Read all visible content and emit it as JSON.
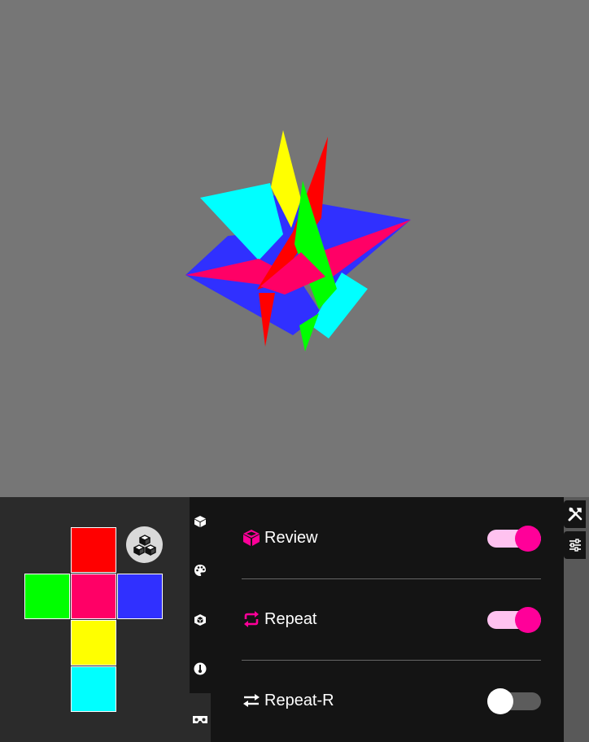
{
  "scene": {
    "background": "#767676",
    "shapes": [
      {
        "color": "#3030ff",
        "desc": "blue triangle right"
      },
      {
        "color": "#3030ff",
        "desc": "blue quad left"
      },
      {
        "color": "#00ffff",
        "desc": "cyan top-left"
      },
      {
        "color": "#00ffff",
        "desc": "cyan bottom-right"
      },
      {
        "color": "#ff0066",
        "desc": "magenta left"
      },
      {
        "color": "#ff0066",
        "desc": "magenta right"
      },
      {
        "color": "#ffff00",
        "desc": "yellow spike"
      },
      {
        "color": "#ff0000",
        "desc": "red spike"
      },
      {
        "color": "#00ff00",
        "desc": "green spike"
      }
    ]
  },
  "cube_net": {
    "faces": {
      "top": "#ff0000",
      "left": "#00ff00",
      "front": "#ff0066",
      "right": "#3030ff",
      "bottom": "#ffff00",
      "back": "#00ffff"
    },
    "scramble_icon": "cubes-icon"
  },
  "tabs": [
    {
      "icon": "cube-icon",
      "active": false
    },
    {
      "icon": "palette-icon",
      "active": false
    },
    {
      "icon": "cube-outline-icon",
      "active": false
    },
    {
      "icon": "thermometer-icon",
      "active": false
    },
    {
      "icon": "vr-goggles-icon",
      "active": true
    }
  ],
  "settings": {
    "review": {
      "label": "Review",
      "icon": "cube-icon",
      "on": true
    },
    "repeat": {
      "label": "Repeat",
      "icon": "repeat-icon",
      "on": true
    },
    "repeat_r": {
      "label": "Repeat-R",
      "icon": "exchange-icon",
      "on": false
    }
  },
  "side_buttons": [
    {
      "icon": "tools-icon"
    },
    {
      "icon": "sliders-icon"
    }
  ],
  "colors": {
    "accent": "#ff0099",
    "toggle_track_on": "#ffc2f0",
    "toggle_track_off": "#5c5c5c",
    "toggle_knob_off": "#ffffff"
  }
}
